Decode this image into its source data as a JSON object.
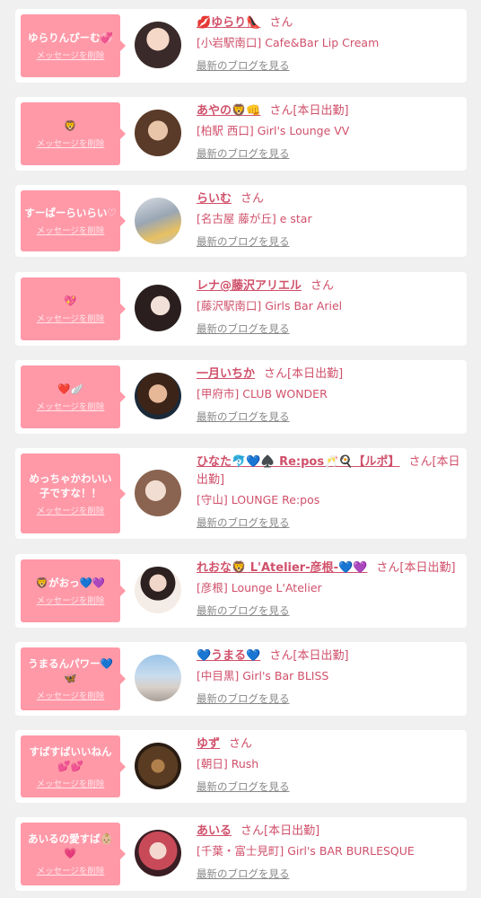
{
  "delete_label": "メッセージを削除",
  "blog_label": "最新のブログを見る",
  "colors": {
    "bubble": "#ff99a8",
    "accent": "#d0506a",
    "background": "#f0f0f0"
  },
  "entries": [
    {
      "message": "ゆらりんぴーむ💞",
      "name": "💋ゆらり👠",
      "honor": "さん",
      "shop": "[小岩駅南口] Cafe&Bar Lip Cream",
      "avatar": "user-photo"
    },
    {
      "message": "🦁",
      "name": "あやの🦁👊",
      "honor": "さん[本日出勤]",
      "shop": "[柏駅 西口] Girl's Lounge VV",
      "avatar": "user-photo"
    },
    {
      "message": "すーぱーらいらい♡",
      "name": "らいむ",
      "honor": "さん",
      "shop": "[名古屋 藤が丘] e star",
      "avatar": "user-photo"
    },
    {
      "message": "💖",
      "name": "レナ@藤沢アリエル",
      "honor": "さん",
      "shop": "[藤沢駅南口] Girls Bar Ariel",
      "avatar": "user-photo"
    },
    {
      "message": "❤️🪽",
      "name": "一月いちか",
      "honor": "さん[本日出勤]",
      "shop": "[甲府市] CLUB WONDER",
      "avatar": "user-photo"
    },
    {
      "message": "めっちゃかわいい子ですな！！",
      "name": "ひなた🐬💙♠️ Re:pos🥂🍳【ルポ】",
      "honor": "さん[本日出勤]",
      "shop": "[守山] LOUNGE Re:pos",
      "avatar": "user-photo"
    },
    {
      "message": "🦁がおっ💙💜",
      "name": "れおな🦁 L'Atelier-彦根-💙💜",
      "honor": "さん[本日出勤]",
      "shop": "[彦根] Lounge L'Atelier",
      "avatar": "user-photo"
    },
    {
      "message": "うまるんパワー💙🦋",
      "name": "💙うまる💙",
      "honor": "さん[本日出勤]",
      "shop": "[中目黒] Girl's Bar BLISS",
      "avatar": "user-photo"
    },
    {
      "message": "すばすばいいねん💕💕",
      "name": "ゆず",
      "honor": "さん",
      "shop": "[朝日] Rush",
      "avatar": "user-photo"
    },
    {
      "message": "あいるの愛すば👶🏼💗",
      "name": "あいる",
      "honor": "さん[本日出勤]",
      "shop": "[千葉・富士見町] Girl's BAR BURLESQUE",
      "avatar": "user-photo"
    }
  ]
}
